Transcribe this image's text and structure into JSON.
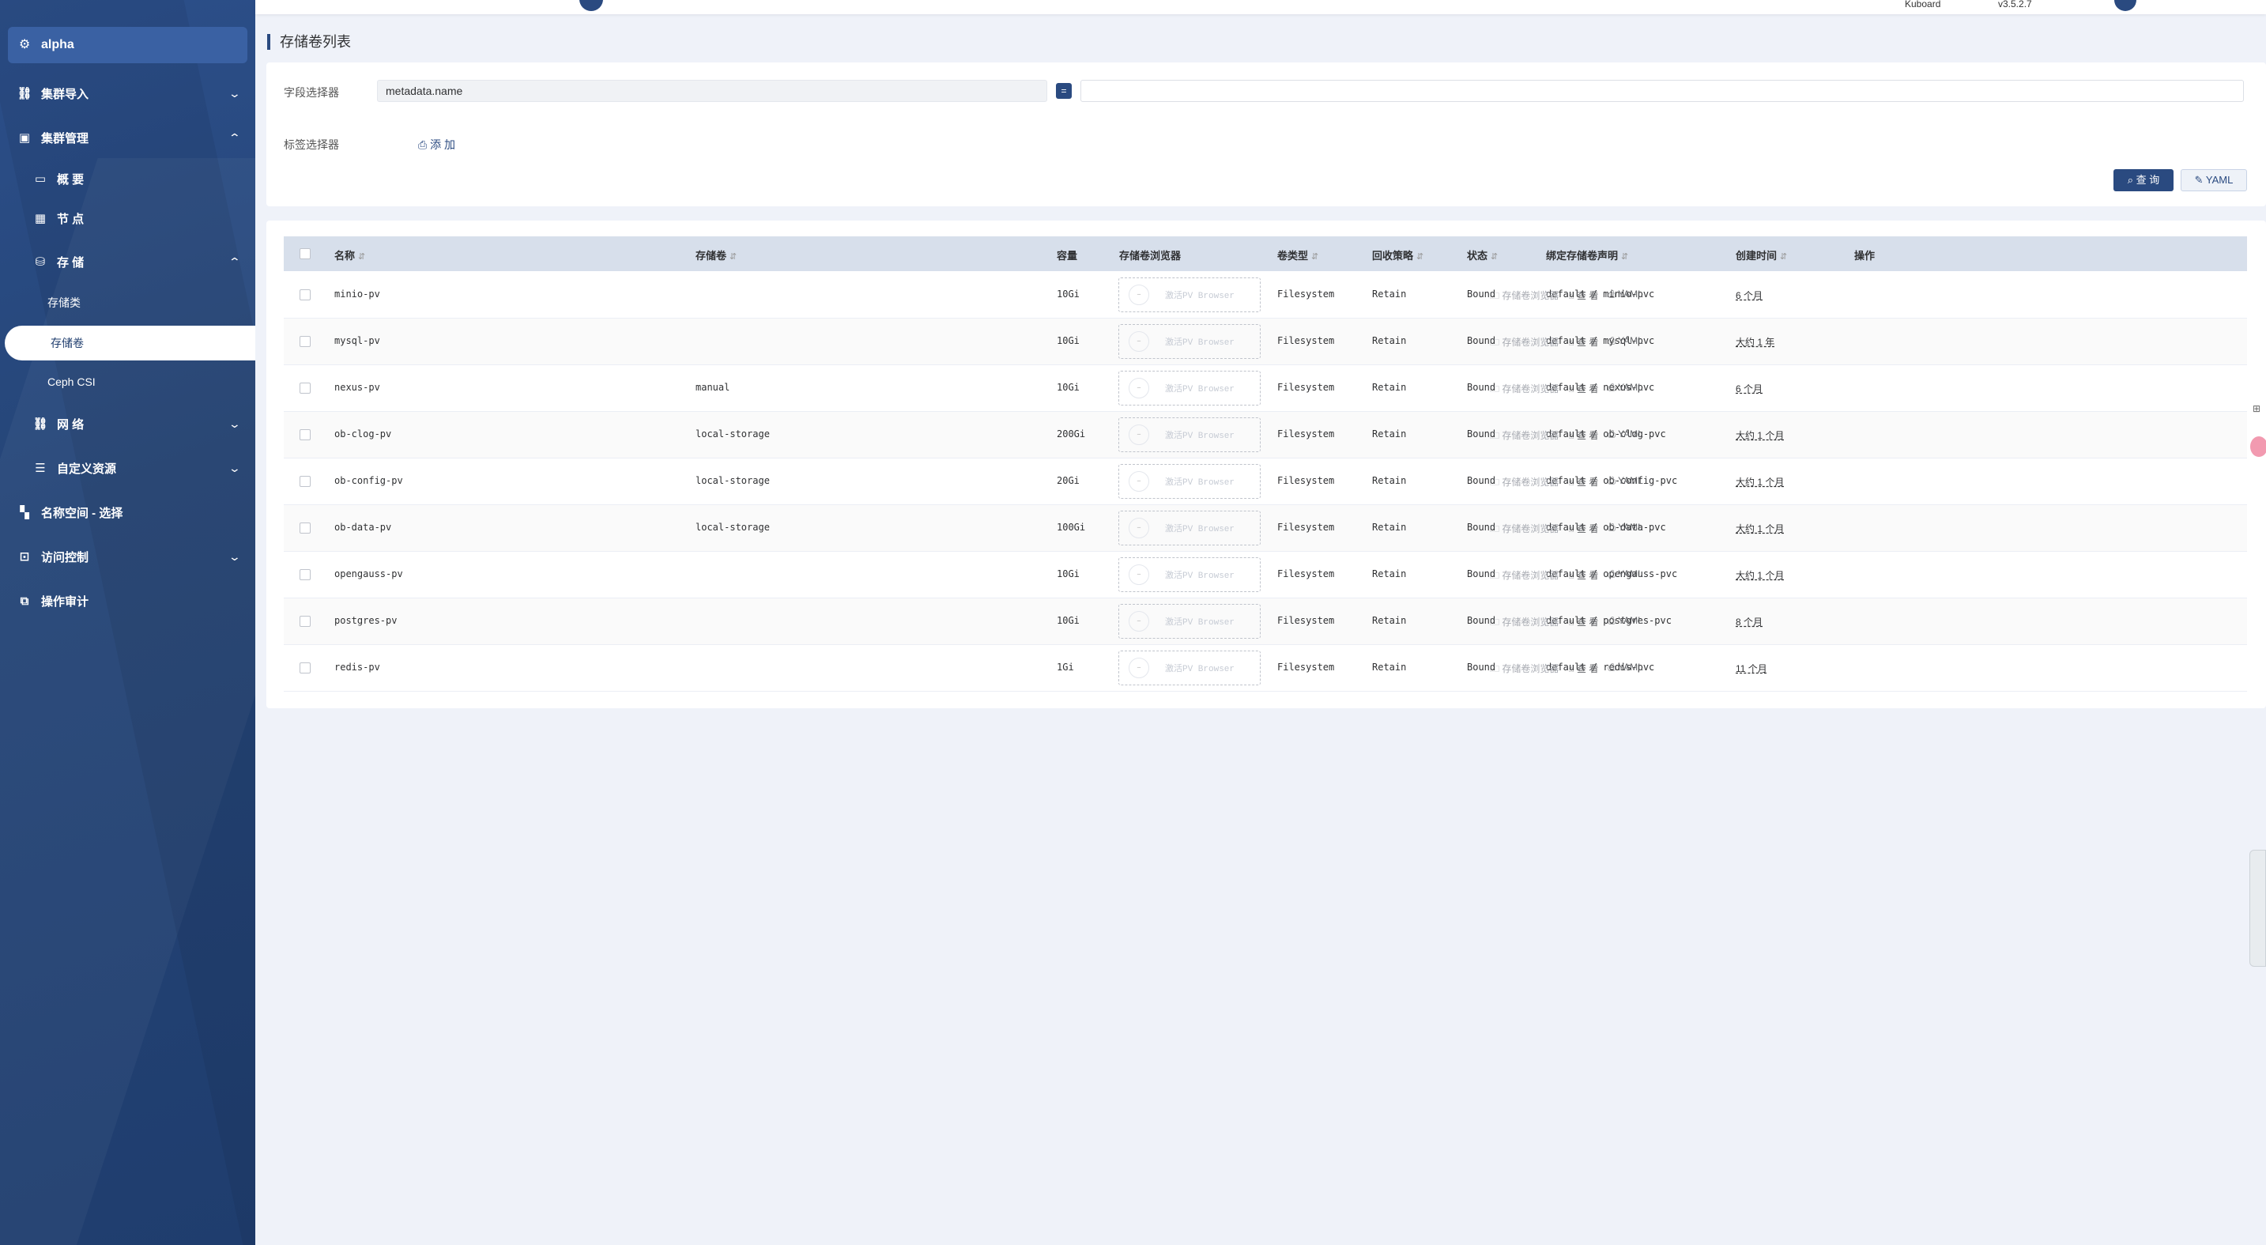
{
  "sidebar": {
    "cluster": "alpha",
    "items": [
      {
        "label": "集群导入"
      },
      {
        "label": "集群管理"
      },
      {
        "label": "概 要"
      },
      {
        "label": "节 点"
      },
      {
        "label": "存 储"
      },
      {
        "label": "存储类"
      },
      {
        "label": "存储卷"
      },
      {
        "label": "Ceph CSI"
      },
      {
        "label": "网 络"
      },
      {
        "label": "自定义资源"
      },
      {
        "label": "名称空间 - 选择"
      },
      {
        "label": "访问控制"
      },
      {
        "label": "操作审计"
      }
    ]
  },
  "topbar": {
    "product": "Kuboard",
    "version": "v3.5.2.7"
  },
  "page": {
    "title": "存储卷列表"
  },
  "filter": {
    "field_selector_label": "字段选择器",
    "field_value": "metadata.name",
    "operator": "=",
    "label_selector_label": "标签选择器",
    "add_label": "添 加",
    "query_button": "查 询",
    "yaml_button": "YAML"
  },
  "table": {
    "headers": {
      "name": "名称",
      "storage_class": "存储卷",
      "capacity": "容量",
      "browser": "存储卷浏览器",
      "volume_mode": "卷类型",
      "reclaim": "回收策略",
      "status": "状态",
      "claim": "绑定存储卷声明",
      "created": "创建时间",
      "actions": "操作"
    },
    "browser_button": "激活PV Browser",
    "actions": {
      "browse": "存储卷浏览器",
      "view": "查 看",
      "yaml": "YAML"
    },
    "rows": [
      {
        "name": "minio-pv",
        "storage_class": "",
        "capacity": "10Gi",
        "mode": "Filesystem",
        "reclaim": "Retain",
        "status": "Bound",
        "claim": "default / minio-pvc",
        "age": "6 个月"
      },
      {
        "name": "mysql-pv",
        "storage_class": "",
        "capacity": "10Gi",
        "mode": "Filesystem",
        "reclaim": "Retain",
        "status": "Bound",
        "claim": "default / mysql-pvc",
        "age": "大约 1 年"
      },
      {
        "name": "nexus-pv",
        "storage_class": "manual",
        "capacity": "10Gi",
        "mode": "Filesystem",
        "reclaim": "Retain",
        "status": "Bound",
        "claim": "default / nexus-pvc",
        "age": "6 个月"
      },
      {
        "name": "ob-clog-pv",
        "storage_class": "local-storage",
        "capacity": "200Gi",
        "mode": "Filesystem",
        "reclaim": "Retain",
        "status": "Bound",
        "claim": "default / ob-clog-pvc",
        "age": "大约 1 个月"
      },
      {
        "name": "ob-config-pv",
        "storage_class": "local-storage",
        "capacity": "20Gi",
        "mode": "Filesystem",
        "reclaim": "Retain",
        "status": "Bound",
        "claim": "default / ob-config-pvc",
        "age": "大约 1 个月"
      },
      {
        "name": "ob-data-pv",
        "storage_class": "local-storage",
        "capacity": "100Gi",
        "mode": "Filesystem",
        "reclaim": "Retain",
        "status": "Bound",
        "claim": "default / ob-data-pvc",
        "age": "大约 1 个月"
      },
      {
        "name": "opengauss-pv",
        "storage_class": "",
        "capacity": "10Gi",
        "mode": "Filesystem",
        "reclaim": "Retain",
        "status": "Bound",
        "claim": "default / opengauss-pvc",
        "age": "大约 1 个月"
      },
      {
        "name": "postgres-pv",
        "storage_class": "",
        "capacity": "10Gi",
        "mode": "Filesystem",
        "reclaim": "Retain",
        "status": "Bound",
        "claim": "default / postgres-pvc",
        "age": "8 个月"
      },
      {
        "name": "redis-pv",
        "storage_class": "",
        "capacity": "1Gi",
        "mode": "Filesystem",
        "reclaim": "Retain",
        "status": "Bound",
        "claim": "default / redis-pvc",
        "age": "11 个月"
      }
    ]
  }
}
